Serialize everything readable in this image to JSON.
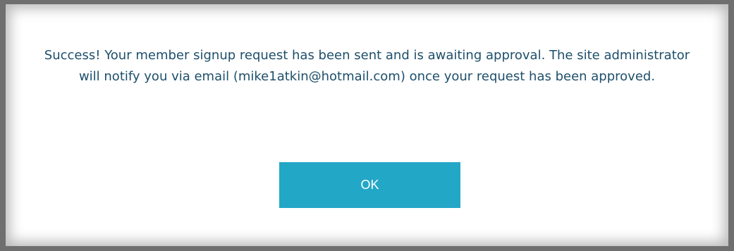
{
  "dialog": {
    "message": "Success! Your member signup request has been sent and is awaiting approval. The site administrator will notify you via email (mike1atkin@hotmail.com) once your request has been approved.",
    "ok_label": "OK"
  },
  "colors": {
    "message_text": "#1d4f6b",
    "button_background": "#23a7c7",
    "button_text": "#ffffff"
  }
}
